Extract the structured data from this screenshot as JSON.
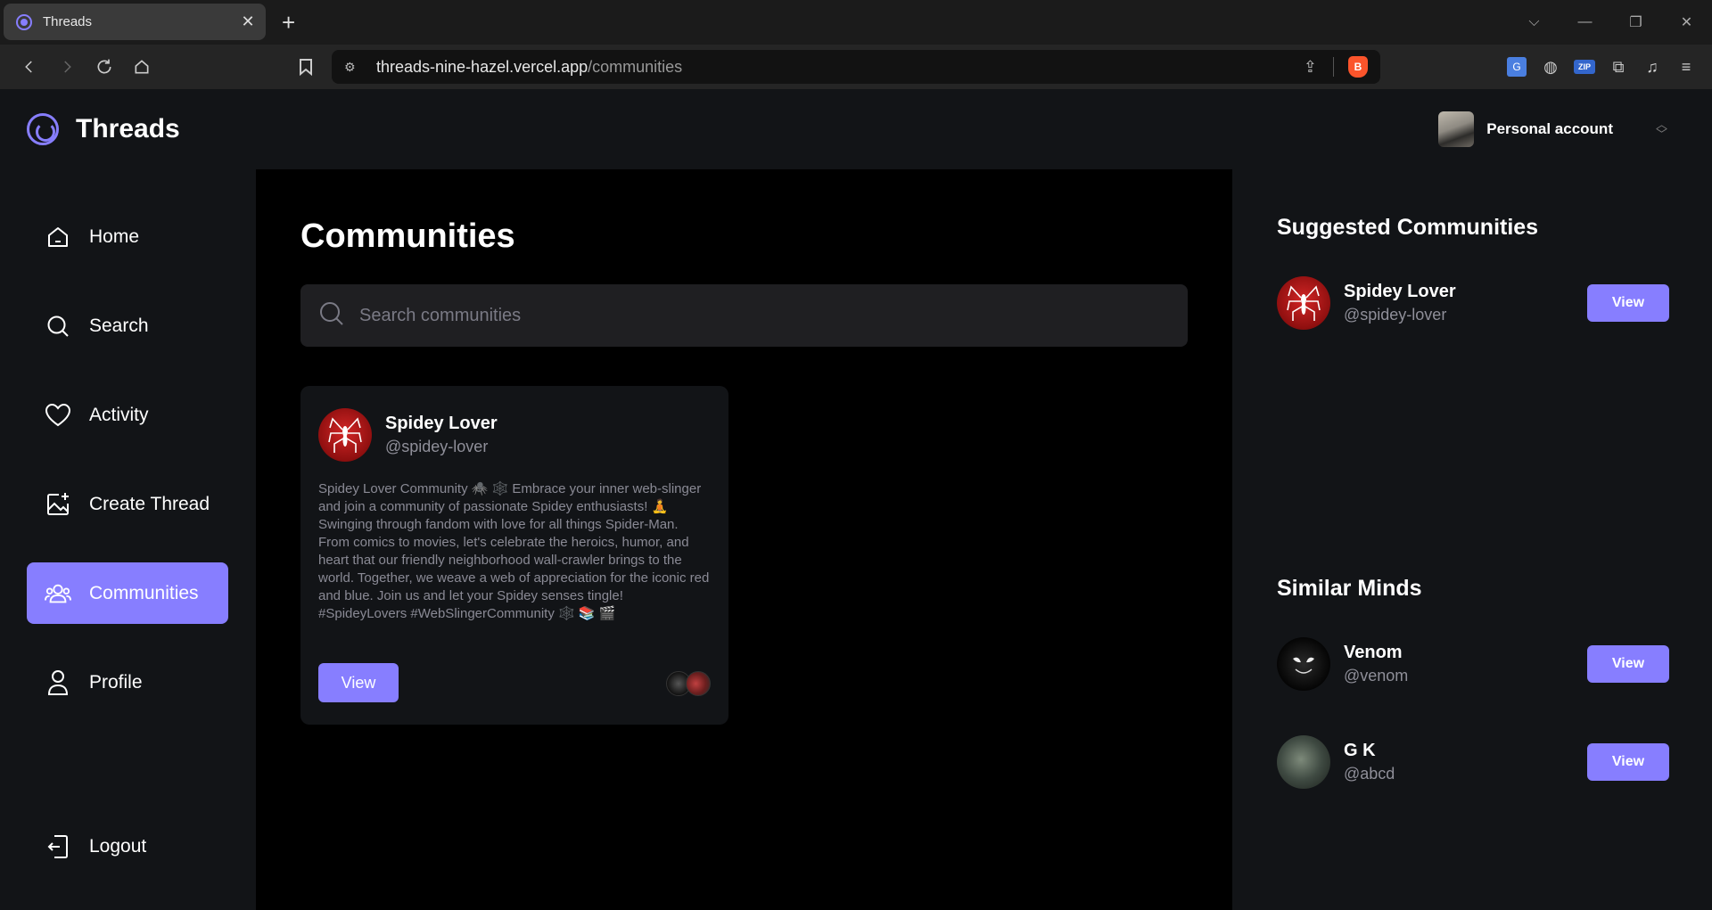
{
  "browser": {
    "tab_title": "Threads",
    "url_host": "threads-nine-hazel.vercel.app",
    "url_path": "/communities"
  },
  "app": {
    "brand": "Threads",
    "account_label": "Personal account"
  },
  "sidebar": {
    "items": [
      {
        "label": "Home",
        "icon": "home-icon"
      },
      {
        "label": "Search",
        "icon": "search-icon"
      },
      {
        "label": "Activity",
        "icon": "heart-icon"
      },
      {
        "label": "Create Thread",
        "icon": "image-plus-icon"
      },
      {
        "label": "Communities",
        "icon": "users-icon",
        "active": true
      },
      {
        "label": "Profile",
        "icon": "user-icon"
      }
    ],
    "logout": "Logout"
  },
  "main": {
    "title": "Communities",
    "search_placeholder": "Search communities",
    "community_card": {
      "name": "Spidey Lover",
      "handle": "@spidey-lover",
      "bio": "Spidey Lover Community 🕷️ 🕸️ Embrace your inner web-slinger and join a community of passionate Spidey enthusiasts! 🧘 Swinging through fandom with love for all things Spider-Man. From comics to movies, let's celebrate the heroics, humor, and heart that our friendly neighborhood wall-crawler brings to the world. Together, we weave a web of appreciation for the iconic red and blue. Join us and let your Spidey senses tingle! #SpideyLovers #WebSlingerCommunity 🕸️ 📚 🎬",
      "button": "View"
    }
  },
  "right": {
    "suggested_title": "Suggested Communities",
    "suggested": [
      {
        "name": "Spidey Lover",
        "handle": "@spidey-lover",
        "button": "View"
      }
    ],
    "similar_title": "Similar Minds",
    "similar": [
      {
        "name": "Venom",
        "handle": "@venom",
        "button": "View"
      },
      {
        "name": "G K",
        "handle": "@abcd",
        "button": "View"
      }
    ]
  },
  "colors": {
    "accent": "#877eff",
    "background": "#121417",
    "main_background": "#000000"
  }
}
